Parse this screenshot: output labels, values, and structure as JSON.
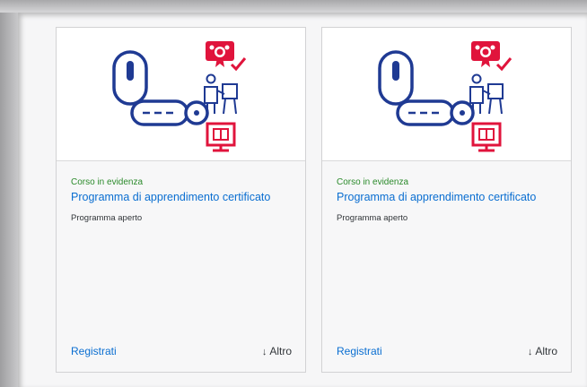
{
  "cards": [
    {
      "eyebrow": "Corso in evidenza",
      "title": "Programma di apprendimento certificato",
      "subtitle": "Programma aperto",
      "register_label": "Registrati",
      "more_label": "Altro",
      "more_icon": "arrow-down-icon",
      "image_icon": "key-lock-certification-icon"
    },
    {
      "eyebrow": "Corso in evidenza",
      "title": "Programma di apprendimento certificato",
      "subtitle": "Programma aperto",
      "register_label": "Registrati",
      "more_label": "Altro",
      "more_icon": "arrow-down-icon",
      "image_icon": "key-lock-certification-icon"
    }
  ],
  "colors": {
    "link": "#0a6ed1",
    "eyebrow": "#2b8a2b",
    "illustration_blue": "#1f3a93",
    "illustration_red": "#e0143c"
  }
}
